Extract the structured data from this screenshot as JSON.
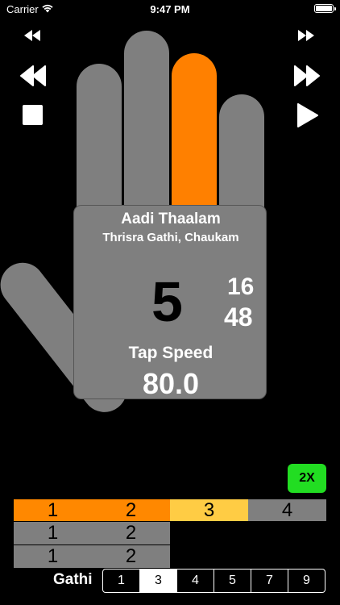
{
  "status_bar": {
    "carrier": "Carrier",
    "time": "9:47 PM"
  },
  "controls": {
    "left": [
      "rewind-small-icon",
      "rewind-icon",
      "stop-icon"
    ],
    "right": [
      "fast-forward-small-icon",
      "fast-forward-icon",
      "play-icon"
    ]
  },
  "hand": {
    "active_finger": 3,
    "active_color": "#ff8000",
    "finger_color": "#7f7f7f"
  },
  "palm": {
    "title": "Aadi Thaalam",
    "subtitle": "Thrisra Gathi, Chaukam",
    "beat": "5",
    "count_top": "16",
    "count_bottom": "48",
    "tap_label": "Tap Speed",
    "tap_value": "80.0"
  },
  "speed_button": {
    "label": "2X",
    "color": "#22dd22"
  },
  "beat_grid": {
    "row1": [
      "1",
      "2",
      "3",
      "4"
    ],
    "row2": [
      "1",
      "2"
    ],
    "row3": [
      "1",
      "2"
    ]
  },
  "gathi": {
    "label": "Gathi",
    "options": [
      "1",
      "3",
      "4",
      "5",
      "7",
      "9"
    ],
    "selected": "3"
  }
}
